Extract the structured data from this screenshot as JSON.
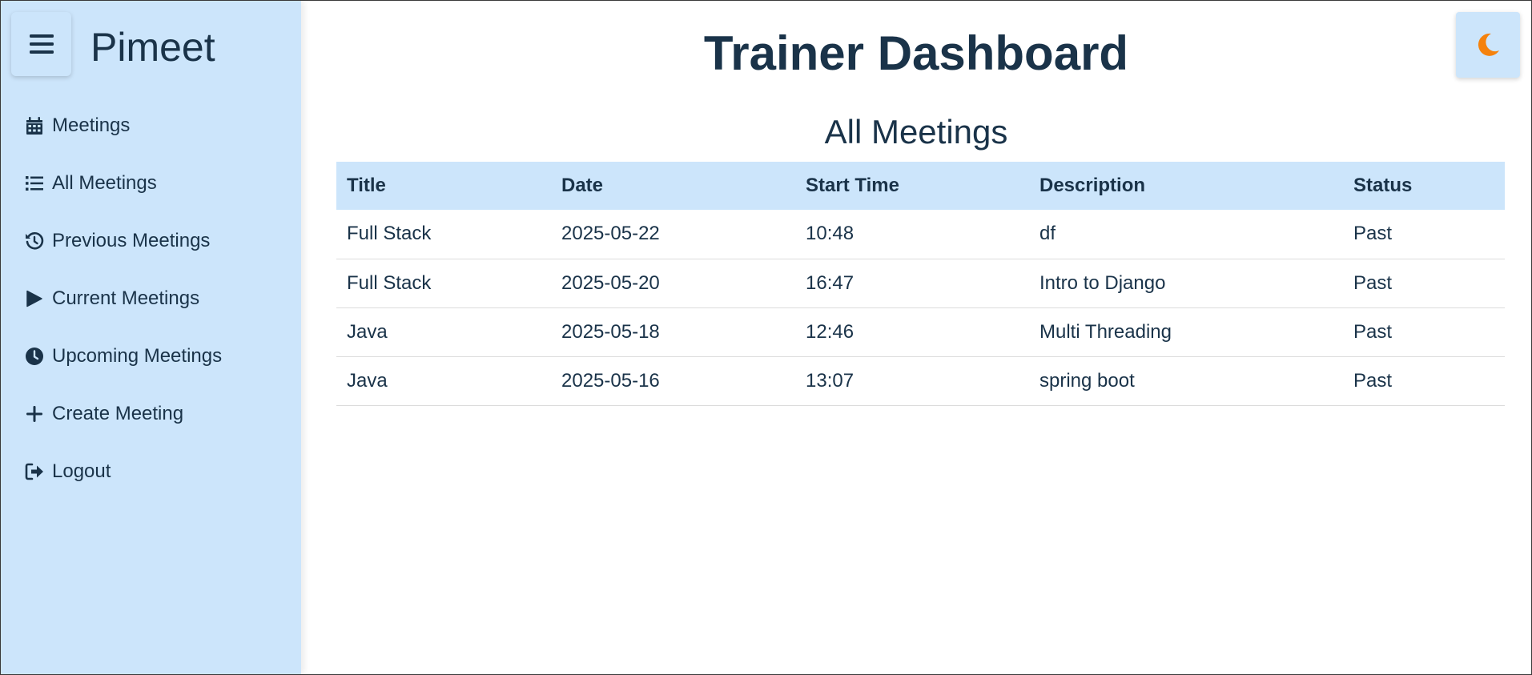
{
  "app": {
    "brand": "Pimeet",
    "menu_icon": "hamburger-icon"
  },
  "sidebar": {
    "items": [
      {
        "label": "Meetings",
        "icon": "calendar-icon"
      },
      {
        "label": "All Meetings",
        "icon": "list-icon"
      },
      {
        "label": "Previous Meetings",
        "icon": "history-icon"
      },
      {
        "label": "Current Meetings",
        "icon": "play-icon"
      },
      {
        "label": "Upcoming Meetings",
        "icon": "clock-icon"
      },
      {
        "label": "Create Meeting",
        "icon": "plus-icon"
      },
      {
        "label": "Logout",
        "icon": "logout-icon"
      }
    ]
  },
  "header": {
    "title": "Trainer Dashboard",
    "theme_toggle_icon": "moon-icon"
  },
  "main": {
    "section_title": "All Meetings",
    "table": {
      "columns": [
        "Title",
        "Date",
        "Start Time",
        "Description",
        "Status"
      ],
      "rows": [
        [
          "Full Stack",
          "2025-05-22",
          "10:48",
          "df",
          "Past"
        ],
        [
          "Full Stack",
          "2025-05-20",
          "16:47",
          "Intro to Django",
          "Past"
        ],
        [
          "Java",
          "2025-05-18",
          "12:46",
          "Multi Threading",
          "Past"
        ],
        [
          "Java",
          "2025-05-16",
          "13:07",
          "spring boot",
          "Past"
        ]
      ]
    }
  },
  "colors": {
    "sidebar_bg": "#cce5fb",
    "text": "#1a3349",
    "moon": "#f5820d"
  }
}
